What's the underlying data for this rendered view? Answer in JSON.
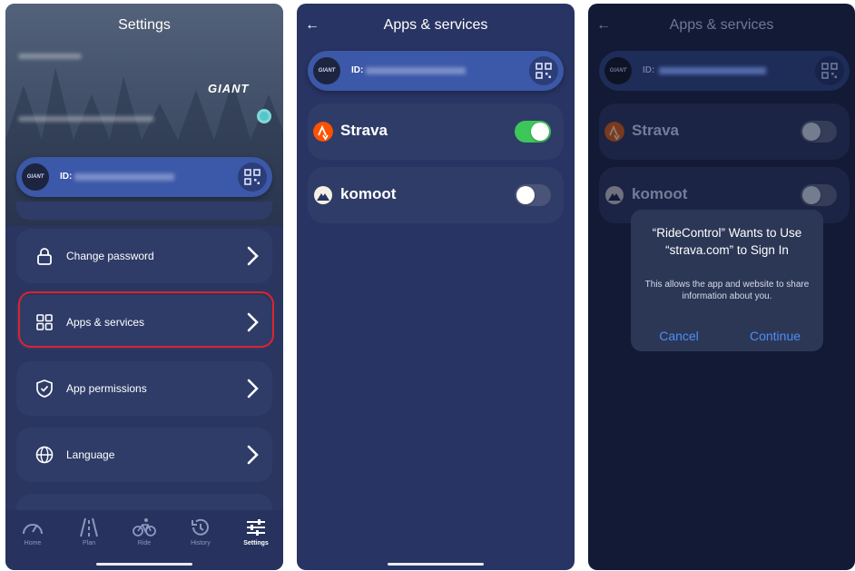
{
  "screen1": {
    "title": "Settings",
    "brand": "GIANT",
    "id_label": "ID:",
    "menu": [
      {
        "label": "Change password",
        "icon": "lock-icon"
      },
      {
        "label": "Apps & services",
        "icon": "grid-icon",
        "highlighted": true
      },
      {
        "label": "App permissions",
        "icon": "shield-icon"
      },
      {
        "label": "Language",
        "icon": "globe-icon"
      }
    ],
    "tabs": [
      {
        "label": "Home",
        "icon": "gauge-icon"
      },
      {
        "label": "Plan",
        "icon": "road-icon"
      },
      {
        "label": "Ride",
        "icon": "bike-icon"
      },
      {
        "label": "History",
        "icon": "history-icon"
      },
      {
        "label": "Settings",
        "icon": "sliders-icon",
        "active": true
      }
    ],
    "highlight_color": "#e0222f"
  },
  "screen2": {
    "title": "Apps & services",
    "back": "←",
    "id_label": "ID:",
    "services": [
      {
        "name": "Strava",
        "enabled": true,
        "color": "#fc5200"
      },
      {
        "name": "komoot",
        "enabled": false,
        "color": "#6aa127"
      }
    ]
  },
  "screen3": {
    "title": "Apps & services",
    "back": "←",
    "id_label": "ID:",
    "services": [
      {
        "name": "Strava",
        "enabled": false
      },
      {
        "name": "komoot",
        "enabled": false
      }
    ],
    "alert": {
      "title": "“RideControl” Wants to Use “strava.com” to Sign In",
      "message": "This allows the app and website to share information about you.",
      "cancel": "Cancel",
      "continue": "Continue"
    }
  },
  "colors": {
    "toggle_on": "#3dc659",
    "accent_blue": "#4e8df2"
  }
}
